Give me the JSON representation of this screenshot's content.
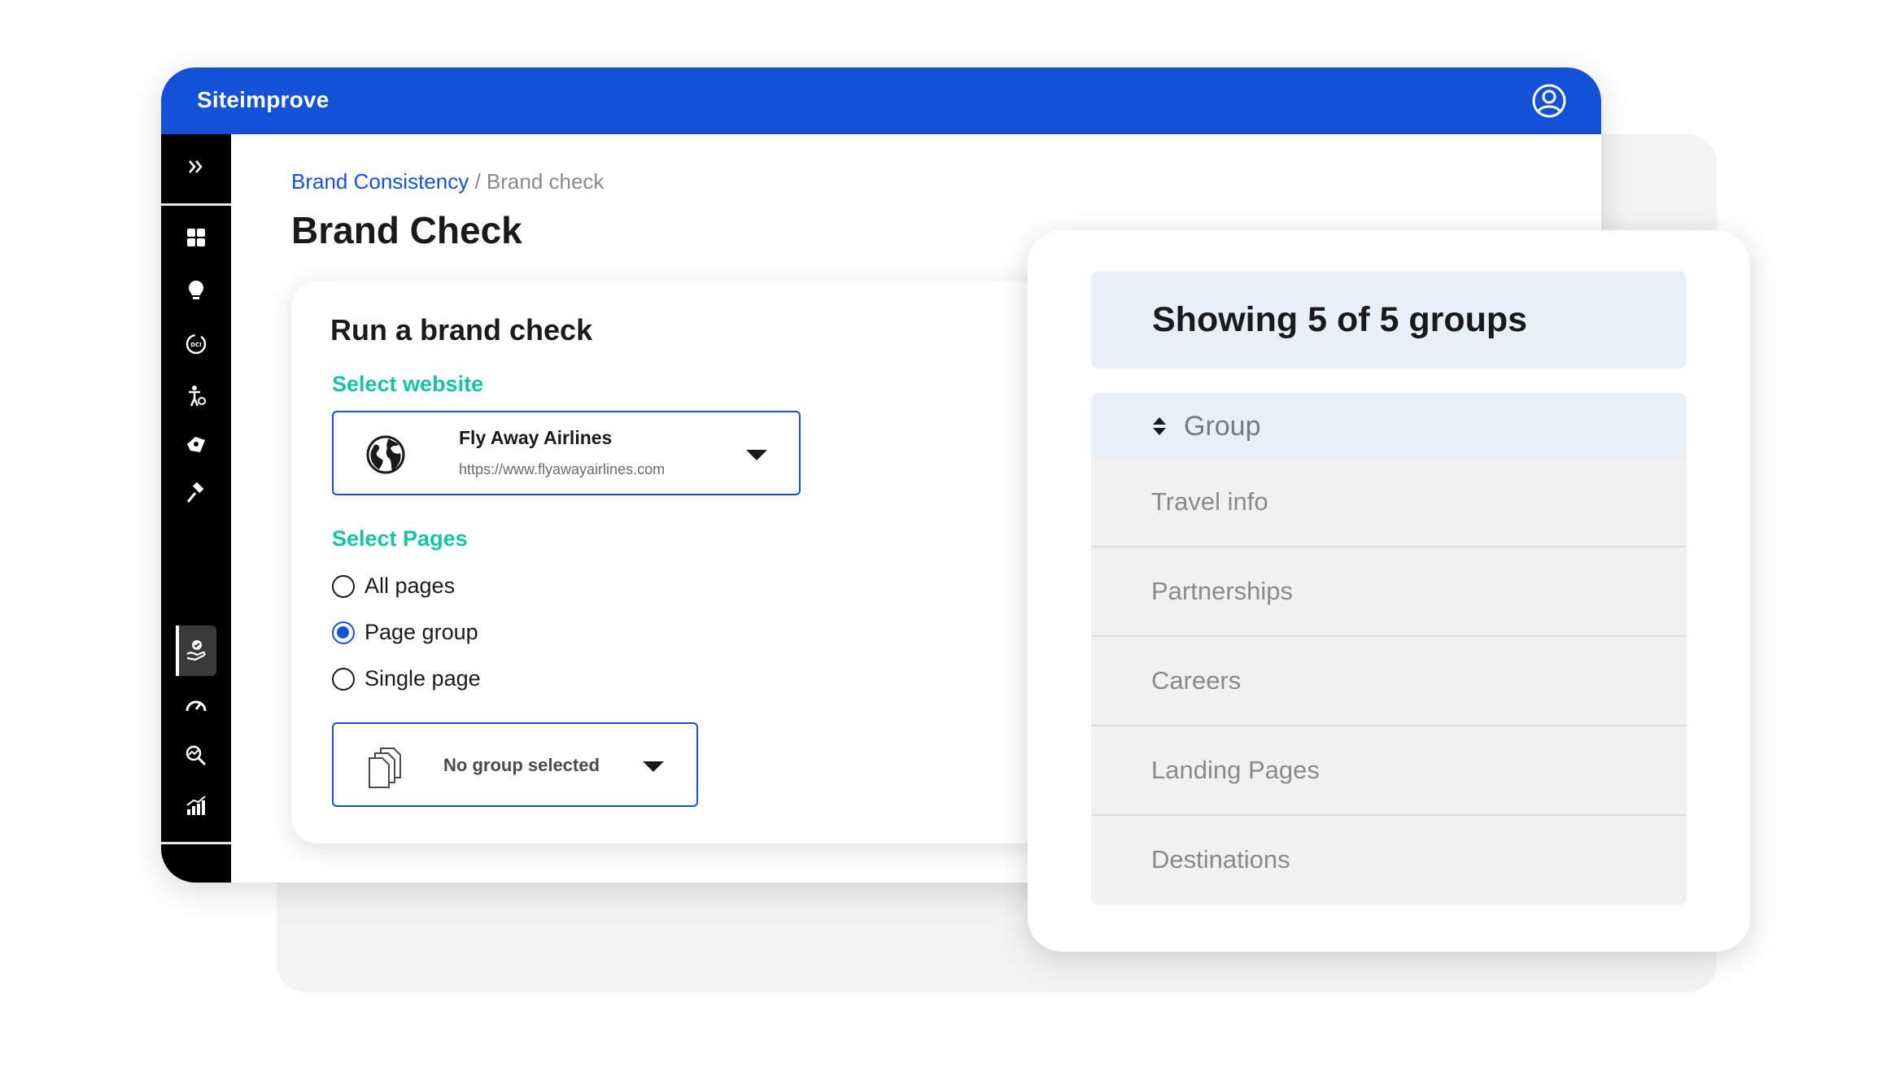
{
  "app": {
    "brand": "Siteimprove"
  },
  "breadcrumb": {
    "parent": "Brand Consistency",
    "separator": " / ",
    "current": "Brand check"
  },
  "page": {
    "title": "Brand Check"
  },
  "run_card": {
    "title": "Run a brand check",
    "select_website_label": "Select website",
    "website": {
      "name": "Fly Away Airlines",
      "url": "https://www.flyawayairlines.com"
    },
    "select_pages_label": "Select Pages",
    "page_options": [
      {
        "label": "All pages",
        "checked": false
      },
      {
        "label": "Page group",
        "checked": true
      },
      {
        "label": "Single page",
        "checked": false
      }
    ],
    "group_select": {
      "value": "No group selected"
    }
  },
  "groups_panel": {
    "showing": "Showing 5 of 5 groups",
    "column_header": "Group",
    "groups": [
      "Travel info",
      "Partnerships",
      "Careers",
      "Landing Pages",
      "Destinations"
    ]
  },
  "icons": {
    "sidebar": [
      "expand-icon",
      "dashboard-icon",
      "lightbulb-icon",
      "dci-icon",
      "accessibility-icon",
      "policy-icon",
      "gavel-icon",
      "brand-consistency-icon",
      "performance-icon",
      "seo-icon",
      "analytics-icon",
      "settings-icon"
    ]
  },
  "colors": {
    "primary": "#1351d8",
    "accent": "#17c3a4",
    "sidebar": "#000000",
    "panel_header": "#e8f0f7"
  }
}
